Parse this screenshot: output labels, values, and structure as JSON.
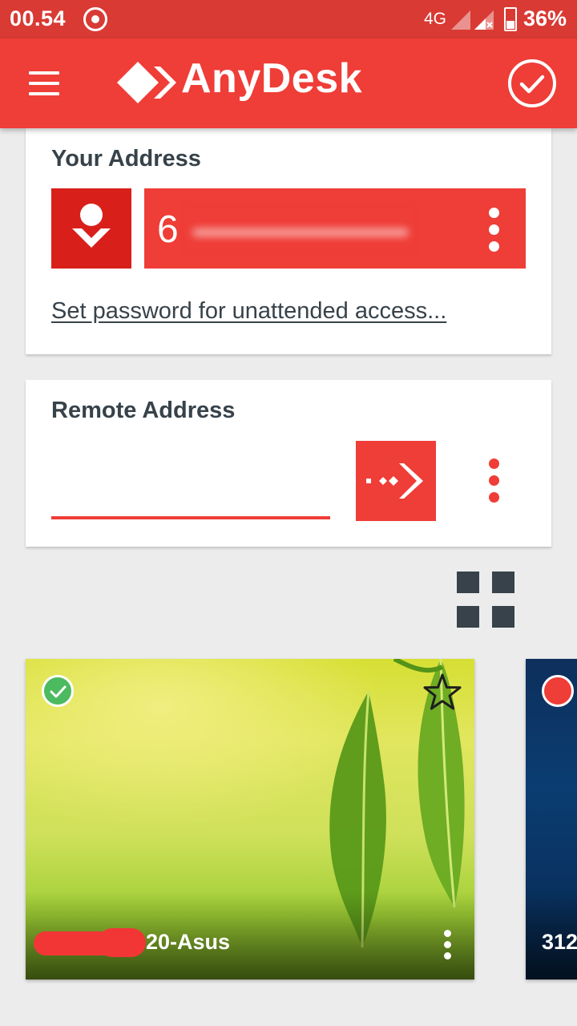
{
  "status_bar": {
    "time": "00.54",
    "network": "4G",
    "battery": "36%"
  },
  "app_bar": {
    "title": "AnyDesk",
    "icons": [
      "menu-icon",
      "anydesk-logo-icon",
      "check-circle-icon"
    ]
  },
  "your_address": {
    "heading": "Your Address",
    "address_visible": "6",
    "password_link": "Set password for unattended access..."
  },
  "remote_address": {
    "heading": "Remote Address",
    "input_value": "",
    "connect_icon": "connect-arrow-icon"
  },
  "view_toggle_icon": "grid-view-icon",
  "recent_sessions": [
    {
      "name_visible": "20-Asus",
      "status": "online",
      "favorite": true
    },
    {
      "name_visible": "312",
      "status": "offline",
      "favorite": false
    }
  ],
  "colors": {
    "status_bar": "#d93a33",
    "accent": "#ef3d37",
    "text_dark": "#37424a",
    "online": "#4cba5f"
  }
}
